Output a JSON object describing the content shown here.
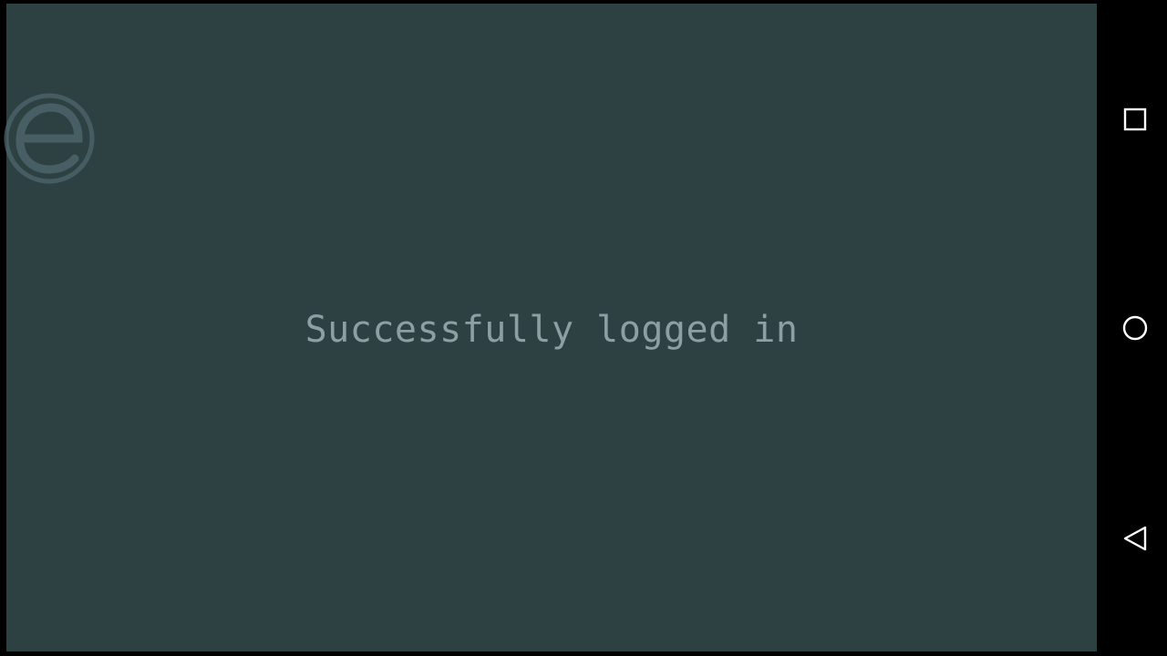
{
  "app": {
    "status_message": "Successfully logged in",
    "background_color": "#2e4142",
    "text_color": "#8e9fa3",
    "logo_icon": "e-logo-icon"
  },
  "navigation_bar": {
    "buttons": [
      {
        "name": "recents",
        "icon": "square-icon"
      },
      {
        "name": "home",
        "icon": "circle-icon"
      },
      {
        "name": "back",
        "icon": "triangle-back-icon"
      }
    ],
    "icon_color": "#ffffff"
  }
}
